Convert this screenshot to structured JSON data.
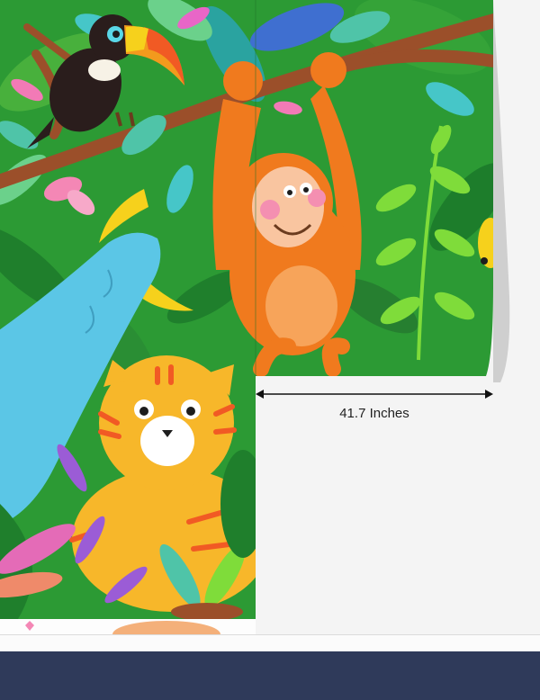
{
  "measurement": {
    "label": "41.7 Inches"
  },
  "colors": {
    "jungle_dark": "#1f8a2e",
    "jungle_mid": "#3aa335",
    "orangutan": "#f07a1e",
    "tiger": "#f7b72a",
    "elephant": "#5bc6e6",
    "toucan_beak": "#f39a1d",
    "banana": "#f6d11c",
    "floor": "#2f3a5a"
  }
}
